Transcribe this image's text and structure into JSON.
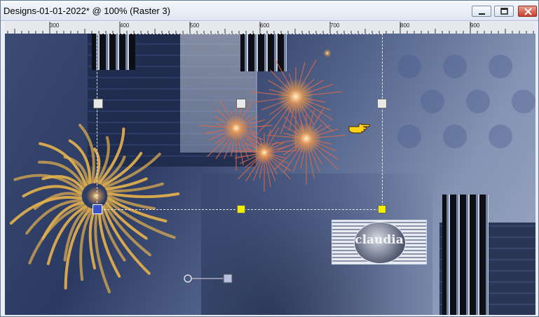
{
  "window": {
    "title": "Designs-01-01-2022* @ 100% (Raster 3)"
  },
  "ruler": {
    "ticks": [
      "300",
      "400",
      "500",
      "600",
      "700",
      "800",
      "900"
    ]
  },
  "canvas": {
    "logo_text": "claudia"
  },
  "colors": {
    "titlebar": "#e6ecf5",
    "canvas_base": "#3b4b72",
    "handle": "#f2ee00",
    "close_button": "#c8402a"
  },
  "icons": {
    "minimize": "minimize-icon",
    "maximize": "maximize-icon",
    "close": "close-icon",
    "pointer": "hand-pointer-icon"
  }
}
